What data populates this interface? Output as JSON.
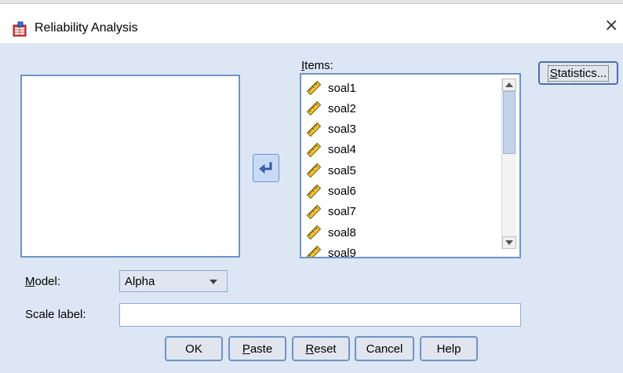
{
  "window": {
    "title": "Reliability Analysis",
    "close_glyph": "×"
  },
  "items_list": {
    "label_first": "I",
    "label_rest": "tems:",
    "items": [
      "soal1",
      "soal2",
      "soal3",
      "soal4",
      "soal5",
      "soal6",
      "soal7",
      "soal8",
      "soal9"
    ]
  },
  "buttons": {
    "statistics_first": "S",
    "statistics_rest": "tatistics...",
    "ok": "OK",
    "paste_first": "P",
    "paste_rest": "aste",
    "reset_first": "R",
    "reset_rest": "eset",
    "cancel": "Cancel",
    "help": "Help"
  },
  "model": {
    "label_first": "M",
    "label_rest": "odel:",
    "selected": "Alpha"
  },
  "scale_label": {
    "label": "Scale label:",
    "value": ""
  },
  "icons": {
    "title_icon": "spss-data-icon",
    "item_icon": "ruler-scale-icon",
    "move_arrow": "move-left-arrow-icon"
  }
}
